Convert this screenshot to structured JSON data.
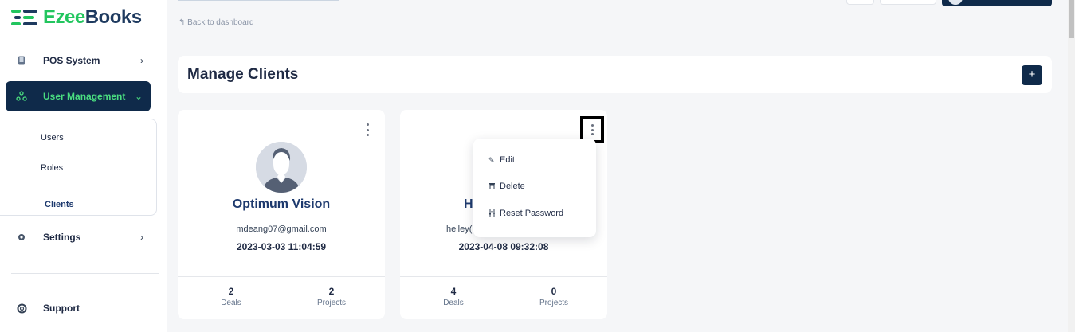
{
  "app": {
    "logo_part1": "Ezee",
    "logo_part2": "Books",
    "brand_green": "#22c55e",
    "brand_navy": "#0f2a4a"
  },
  "sidebar": {
    "pos_system": "POS System",
    "user_management": "User Management",
    "submenu": {
      "users": "Users",
      "roles": "Roles",
      "clients": "Clients"
    },
    "settings": "Settings",
    "support": "Support"
  },
  "top": {
    "back_link": "Back to dashboard"
  },
  "header": {
    "title": "Manage Clients",
    "add_label": "+"
  },
  "clients": [
    {
      "name": "Optimum Vision",
      "email": "mdeang07@gmail.com",
      "created": "2023-03-03 11:04:59",
      "deals": "2",
      "deals_label": "Deals",
      "projects": "2",
      "projects_label": "Projects"
    },
    {
      "name_visible": "H",
      "email_visible": "heiley(",
      "created": "2023-04-08 09:32:08",
      "deals": "4",
      "deals_label": "Deals",
      "projects": "0",
      "projects_label": "Projects"
    }
  ],
  "dropdown": {
    "edit": "Edit",
    "delete": "Delete",
    "reset_password": "Reset Password"
  }
}
